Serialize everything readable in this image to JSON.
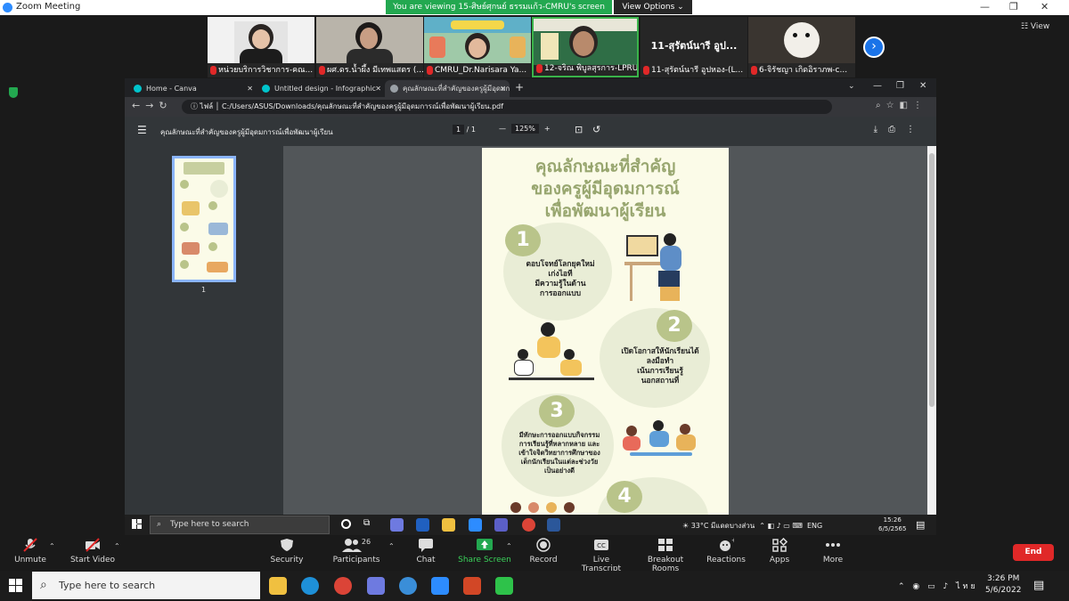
{
  "zoom": {
    "window_title": "Zoom Meeting",
    "banner": "You are viewing 15-ศิษย์ศุกนย์ ธรรมแก้ว-CMRU's screen",
    "view_options": "View Options ⌄",
    "view_label": "☷ View",
    "participants": [
      {
        "name": "หน่วยบริการวิชาการ-คณ...",
        "color": "#f2f2f2"
      },
      {
        "name": "ผศ.ดร.น้ำผึ้ง มีเทพแสตร (...",
        "color": "#6b6864"
      },
      {
        "name": "CMRU_Dr.Narisara Ya...",
        "color": "#9fc9a8"
      },
      {
        "name": "12-จริณ พิบูลสุรการ-LPRU",
        "color": "#2f6e46"
      },
      {
        "name": "11-สุรัตน์นารี อูปหอง-(L...",
        "color": "#262626",
        "big_text": "11-สุรัตน์นารี อูป..."
      },
      {
        "name": "6-จิรัชญา เกิดอิราภพ-c...",
        "color": "#3a3530"
      }
    ],
    "controls": [
      {
        "label": "Unmute",
        "icon": "mic-off-icon"
      },
      {
        "label": "Start Video",
        "icon": "video-off-icon"
      },
      {
        "label": "Security",
        "icon": "shield-icon"
      },
      {
        "label": "Participants",
        "icon": "participants-icon",
        "count": "26"
      },
      {
        "label": "Chat",
        "icon": "chat-icon"
      },
      {
        "label": "Share Screen",
        "icon": "share-screen-icon"
      },
      {
        "label": "Record",
        "icon": "record-icon"
      },
      {
        "label": "Live Transcript",
        "icon": "cc-icon"
      },
      {
        "label": "Breakout Rooms",
        "icon": "breakout-icon"
      },
      {
        "label": "Reactions",
        "icon": "reactions-icon"
      },
      {
        "label": "Apps",
        "icon": "apps-icon"
      },
      {
        "label": "More",
        "icon": "more-icon"
      }
    ],
    "end_label": "End"
  },
  "chrome": {
    "tabs": [
      {
        "title": "Home - Canva",
        "color": "#00c4cc"
      },
      {
        "title": "Untitled design - Infographic",
        "color": "#00c4cc"
      },
      {
        "title": "คุณลักษณะที่สำคัญของครูผู้มีอุดมการณ์",
        "color": "#9aa0a6"
      }
    ],
    "url_prefix": "ไฟล์",
    "url": "C:/Users/ASUS/Downloads/คุณลักษณะที่สำคัญของครูผู้มีอุดมการณ์เพื่อพัฒนาผู้เรียน.pdf",
    "pdf_title": "คุณลักษณะที่สำคัญของครูผู้มีอุดมการณ์เพื่อพัฒนาผู้เรียน",
    "page_current": "1",
    "page_total": "/ 1",
    "zoom": "125%",
    "thumb_page": "1"
  },
  "infographic": {
    "title1": "คุณลักษณะที่สำคัญ",
    "title2": "ของครูผู้มีอุดมการณ์",
    "title3": "เพื่อพัฒนาผู้เรียน",
    "n1": "1",
    "t1a": "ตอบโจทย์โลกยุคใหม่",
    "t1b": "เก่งไอที",
    "t1c": "มีความรู้ในด้าน",
    "t1d": "การออกแบบ",
    "n2": "2",
    "t2a": "เปิดโอกาสให้นักเรียนได้",
    "t2b": "ลงมือทำ",
    "t2c": "เน้นการเรียนรู้",
    "t2d": "นอกสถานที่",
    "n3": "3",
    "t3a": "มีทักษะการออกแบบกิจกรรม",
    "t3b": "การเรียนรู้ที่หลากหลาย และ",
    "t3c": "เข้าใจจิตวิทยาการศึกษาของ",
    "t3d": "เด็กนักเรียนในแต่ละช่วงวัย",
    "t3e": "เป็นอย่างดี",
    "n4": "4"
  },
  "inner_taskbar": {
    "search": "Type here to search",
    "weather": "33°C มีแดดบางส่วน",
    "lang": "ENG",
    "time": "15:26",
    "date": "6/5/2565"
  },
  "outer_taskbar": {
    "search": "Type here to search",
    "lang": "ไทย",
    "time": "3:26 PM",
    "date": "5/6/2022"
  }
}
